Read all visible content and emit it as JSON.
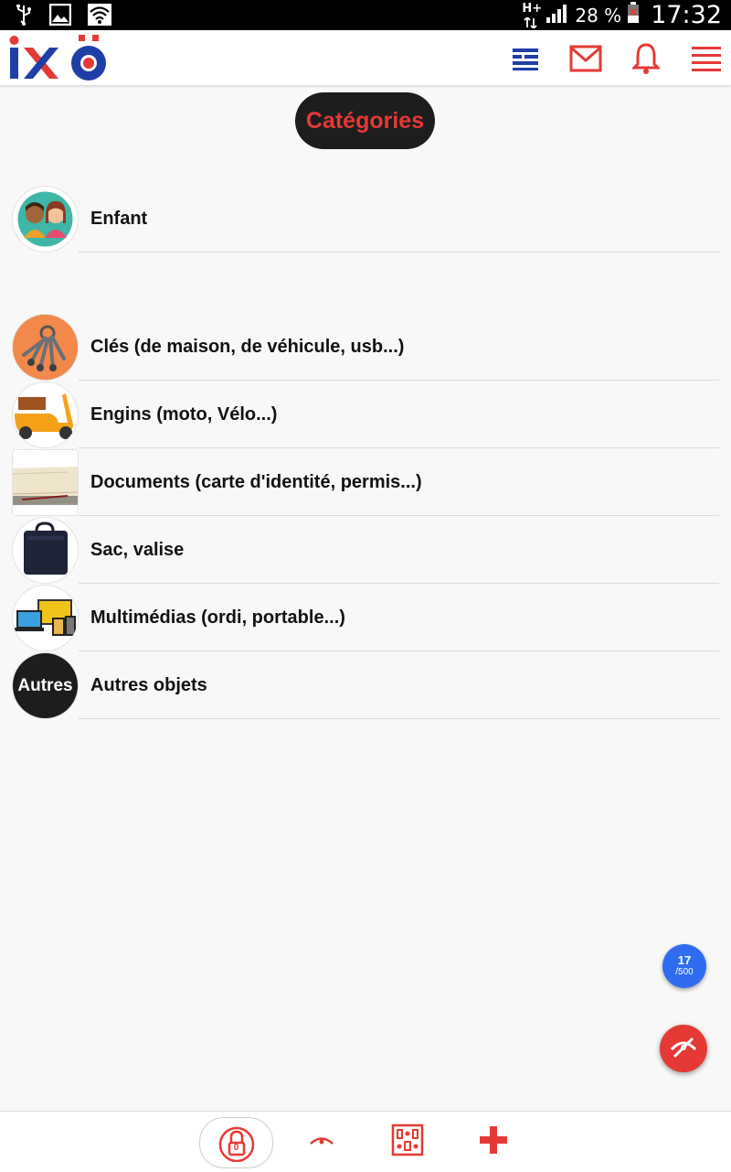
{
  "status_bar": {
    "icons": [
      "usb-icon",
      "image-icon",
      "wifi-icon",
      "network-icon",
      "signal-icon",
      "battery-icon"
    ],
    "network": "H+",
    "battery": "28 %",
    "time": "17:32"
  },
  "app_bar": {
    "logo_text": "IXÖ",
    "icons": [
      "news-icon",
      "mail-icon",
      "bell-icon",
      "menu-icon"
    ]
  },
  "page": {
    "title": "Catégories"
  },
  "categories": [
    {
      "label": "Enfant",
      "icon": "children-icon"
    },
    {
      "label": "Clés (de maison, de véhicule, usb...)",
      "icon": "keys-icon"
    },
    {
      "label": "Engins (moto, Vélo...)",
      "icon": "scooter-icon"
    },
    {
      "label": "Documents (carte d'identité, permis...)",
      "icon": "documents-icon"
    },
    {
      "label": "Sac, valise",
      "icon": "bag-icon"
    },
    {
      "label": "Multimédias (ordi, portable...)",
      "icon": "devices-icon"
    },
    {
      "label": "Autres objets",
      "icon": "other-icon",
      "thumb_text": "Autres"
    }
  ],
  "counter": {
    "value": "17",
    "max": "/500"
  },
  "bottom_bar": {
    "items": [
      "lock-icon",
      "eye-icon",
      "grid-icon",
      "plus-icon"
    ],
    "lock_badge": "0"
  },
  "colors": {
    "accent": "#e53935",
    "brand_blue": "#1e3ea8",
    "counter_blue": "#2f6cf0",
    "pill_bg": "#1d1d1d"
  }
}
